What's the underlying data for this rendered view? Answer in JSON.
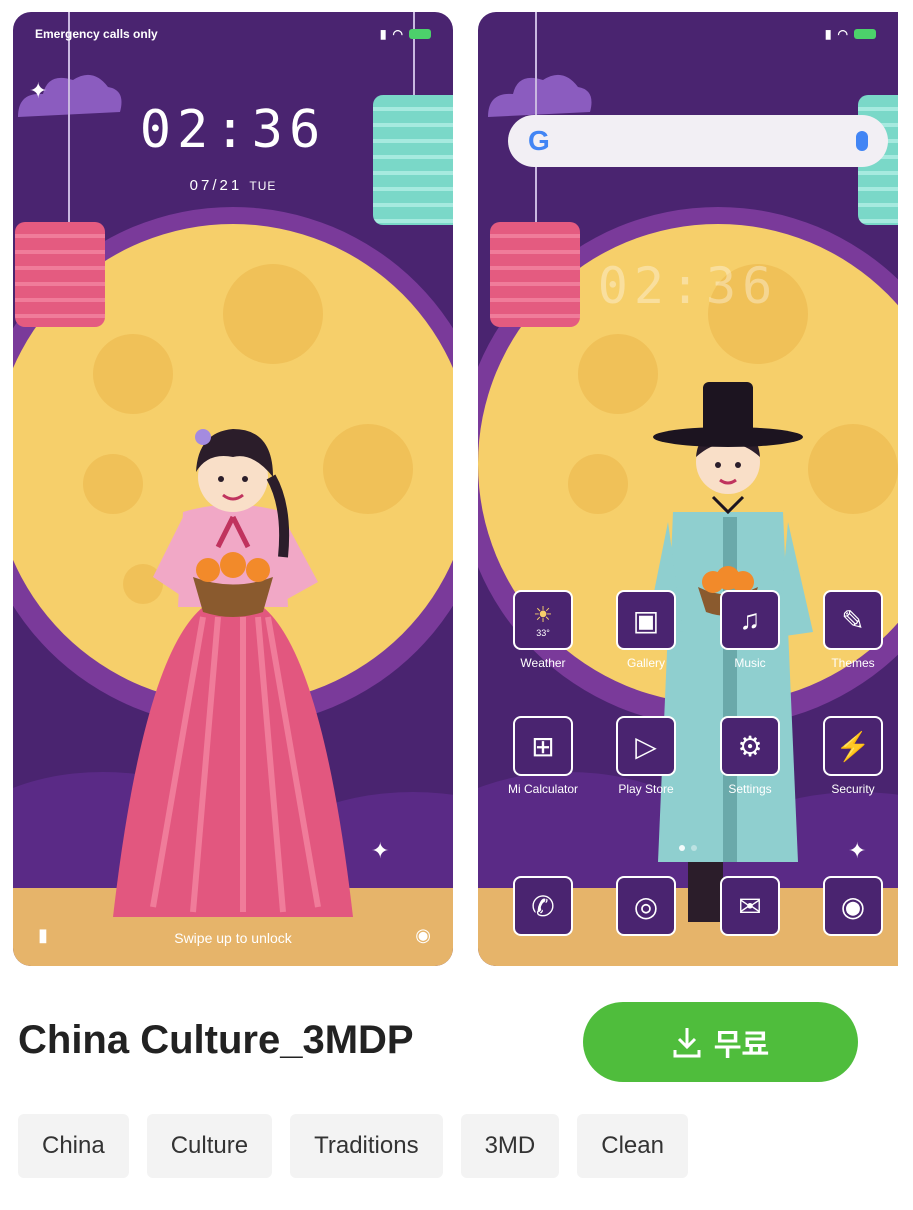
{
  "lock_screen": {
    "status_text": "Emergency calls only",
    "clock": "02:36",
    "date": "07/21",
    "weekday": "TUE",
    "swipe_text": "Swipe up to unlock"
  },
  "home_screen": {
    "clock": "02:36",
    "apps_row1": [
      {
        "label": "Weather",
        "icon": "sun-icon",
        "glyph": "☀",
        "extra": "33°"
      },
      {
        "label": "Gallery",
        "icon": "image-icon",
        "glyph": "▣"
      },
      {
        "label": "Music",
        "icon": "headphones-icon",
        "glyph": "♫"
      },
      {
        "label": "Themes",
        "icon": "brush-icon",
        "glyph": "✎"
      }
    ],
    "apps_row2": [
      {
        "label": "Mi Calculator",
        "icon": "calculator-icon",
        "glyph": "⊞"
      },
      {
        "label": "Play Store",
        "icon": "play-icon",
        "glyph": "▷"
      },
      {
        "label": "Settings",
        "icon": "gear-icon",
        "glyph": "⚙"
      },
      {
        "label": "Security",
        "icon": "shield-icon",
        "glyph": "⚡"
      }
    ],
    "dock": [
      {
        "icon": "phone-icon",
        "glyph": "✆"
      },
      {
        "icon": "globe-icon",
        "glyph": "◎"
      },
      {
        "icon": "messages-icon",
        "glyph": "✉"
      },
      {
        "icon": "camera-icon",
        "glyph": "◉"
      }
    ]
  },
  "theme": {
    "title": "China Culture_3MDP",
    "download_label": "무료",
    "tags": [
      "China",
      "Culture",
      "Traditions",
      "3MD",
      "Clean"
    ]
  },
  "colors": {
    "background_purple": "#4a2470",
    "moon": "#f6cf6a",
    "accent_green": "#4fbd3c"
  }
}
